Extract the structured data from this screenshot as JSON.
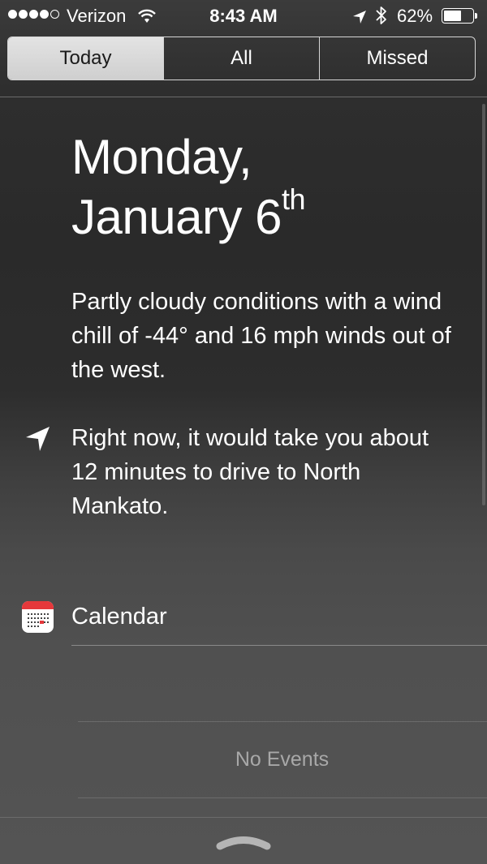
{
  "status_bar": {
    "carrier": "Verizon",
    "time": "8:43 AM",
    "battery_percent": "62%",
    "battery_level": 0.62,
    "signal_bars_filled": 4,
    "signal_bars_total": 5,
    "icons": [
      "wifi-icon",
      "location-arrow-icon",
      "bluetooth-icon",
      "battery-icon"
    ]
  },
  "tabs": [
    {
      "label": "Today",
      "active": true
    },
    {
      "label": "All",
      "active": false
    },
    {
      "label": "Missed",
      "active": false
    }
  ],
  "summary": {
    "date_line1": "Monday,",
    "date_line2": "January 6",
    "date_suffix": "th",
    "weather_text": "Partly cloudy conditions with a wind chill of -44° and 16 mph winds out of the west.",
    "traffic_text": "Right now, it would take you about 12 minutes to drive to North Mankato.",
    "traffic_icon": "navigation-arrow-icon"
  },
  "calendar": {
    "label": "Calendar",
    "icon": "calendar-icon",
    "empty_text": "No Events"
  },
  "colors": {
    "background_top": "#2a2a2a",
    "background_bottom": "#545454",
    "segment_active": "#d9d9d9",
    "calendar_red": "#e5383b",
    "muted_text": "#a8a8a8"
  }
}
